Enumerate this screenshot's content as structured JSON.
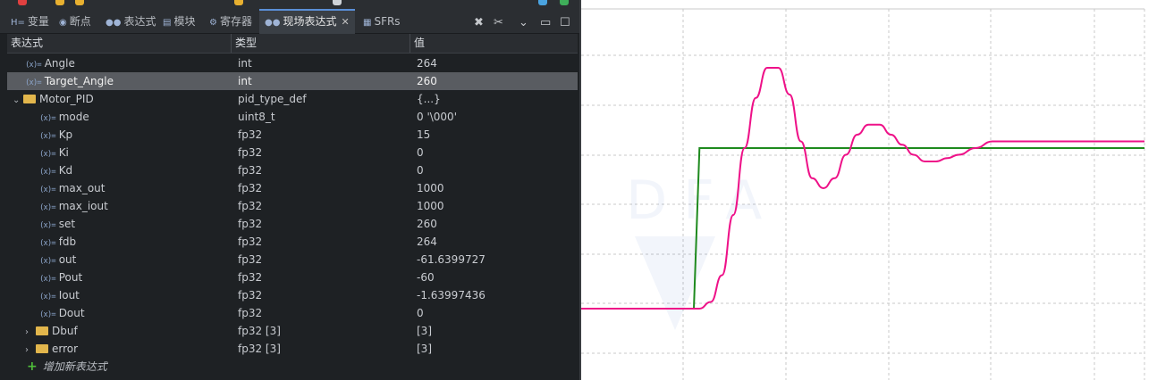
{
  "tabs": [
    {
      "label": "变量",
      "icon": "variables-icon"
    },
    {
      "label": "断点",
      "icon": "breakpoints-icon"
    },
    {
      "label": "表达式",
      "icon": "expressions-icon"
    },
    {
      "label": "模块",
      "icon": "modules-icon"
    },
    {
      "label": "寄存器",
      "icon": "registers-icon"
    },
    {
      "label": "现场表达式",
      "icon": "live-expressions-icon",
      "active": true
    },
    {
      "label": "SFRs",
      "icon": "sfrs-icon"
    }
  ],
  "columns": {
    "expression": "表达式",
    "type": "类型",
    "value": "值"
  },
  "rows": [
    {
      "name": "Angle",
      "type": "int",
      "value": "264",
      "indent": 1,
      "kind": "var"
    },
    {
      "name": "Target_Angle",
      "type": "int",
      "value": "260",
      "indent": 1,
      "kind": "var",
      "selected": true
    },
    {
      "name": "Motor_PID",
      "type": "pid_type_def",
      "value": "{...}",
      "indent": 0,
      "kind": "struct",
      "expanded": true
    },
    {
      "name": "mode",
      "type": "uint8_t",
      "value": "0 '\\000'",
      "indent": 2,
      "kind": "var"
    },
    {
      "name": "Kp",
      "type": "fp32",
      "value": "15",
      "indent": 2,
      "kind": "var"
    },
    {
      "name": "Ki",
      "type": "fp32",
      "value": "0",
      "indent": 2,
      "kind": "var"
    },
    {
      "name": "Kd",
      "type": "fp32",
      "value": "0",
      "indent": 2,
      "kind": "var"
    },
    {
      "name": "max_out",
      "type": "fp32",
      "value": "1000",
      "indent": 2,
      "kind": "var"
    },
    {
      "name": "max_iout",
      "type": "fp32",
      "value": "1000",
      "indent": 2,
      "kind": "var"
    },
    {
      "name": "set",
      "type": "fp32",
      "value": "260",
      "indent": 2,
      "kind": "var"
    },
    {
      "name": "fdb",
      "type": "fp32",
      "value": "264",
      "indent": 2,
      "kind": "var"
    },
    {
      "name": "out",
      "type": "fp32",
      "value": "-61.6399727",
      "indent": 2,
      "kind": "var"
    },
    {
      "name": "Pout",
      "type": "fp32",
      "value": "-60",
      "indent": 2,
      "kind": "var"
    },
    {
      "name": "Iout",
      "type": "fp32",
      "value": "-1.63997436",
      "indent": 2,
      "kind": "var"
    },
    {
      "name": "Dout",
      "type": "fp32",
      "value": "0",
      "indent": 2,
      "kind": "var"
    },
    {
      "name": "Dbuf",
      "type": "fp32 [3]",
      "value": "[3]",
      "indent": 1,
      "kind": "array",
      "expanded": false
    },
    {
      "name": "error",
      "type": "fp32 [3]",
      "value": "[3]",
      "indent": 1,
      "kind": "array",
      "expanded": false
    }
  ],
  "add_expression_label": "增加新表达式",
  "colors": {
    "target_series": "#1e8a1e",
    "actual_series": "#ee1188",
    "grid": "#c8c8c8"
  },
  "chart_data": {
    "type": "line",
    "series": [
      {
        "points": [
          [
            0,
            0
          ],
          [
            0.2,
            0
          ],
          [
            0.21,
            0.48
          ],
          [
            1,
            0.48
          ]
        ]
      },
      {
        "points": [
          [
            0,
            0
          ],
          [
            0.21,
            0
          ],
          [
            0.23,
            0.02
          ],
          [
            0.25,
            0.1
          ],
          [
            0.27,
            0.28
          ],
          [
            0.29,
            0.48
          ],
          [
            0.31,
            0.63
          ],
          [
            0.33,
            0.72
          ],
          [
            0.35,
            0.72
          ],
          [
            0.37,
            0.64
          ],
          [
            0.39,
            0.5
          ],
          [
            0.41,
            0.39
          ],
          [
            0.43,
            0.36
          ],
          [
            0.45,
            0.39
          ],
          [
            0.47,
            0.46
          ],
          [
            0.49,
            0.52
          ],
          [
            0.51,
            0.55
          ],
          [
            0.53,
            0.55
          ],
          [
            0.55,
            0.52
          ],
          [
            0.57,
            0.49
          ],
          [
            0.59,
            0.46
          ],
          [
            0.61,
            0.44
          ],
          [
            0.63,
            0.44
          ],
          [
            0.65,
            0.45
          ],
          [
            0.67,
            0.46
          ],
          [
            0.7,
            0.48
          ],
          [
            0.73,
            0.5
          ],
          [
            1,
            0.5
          ]
        ]
      }
    ],
    "grid": true
  }
}
